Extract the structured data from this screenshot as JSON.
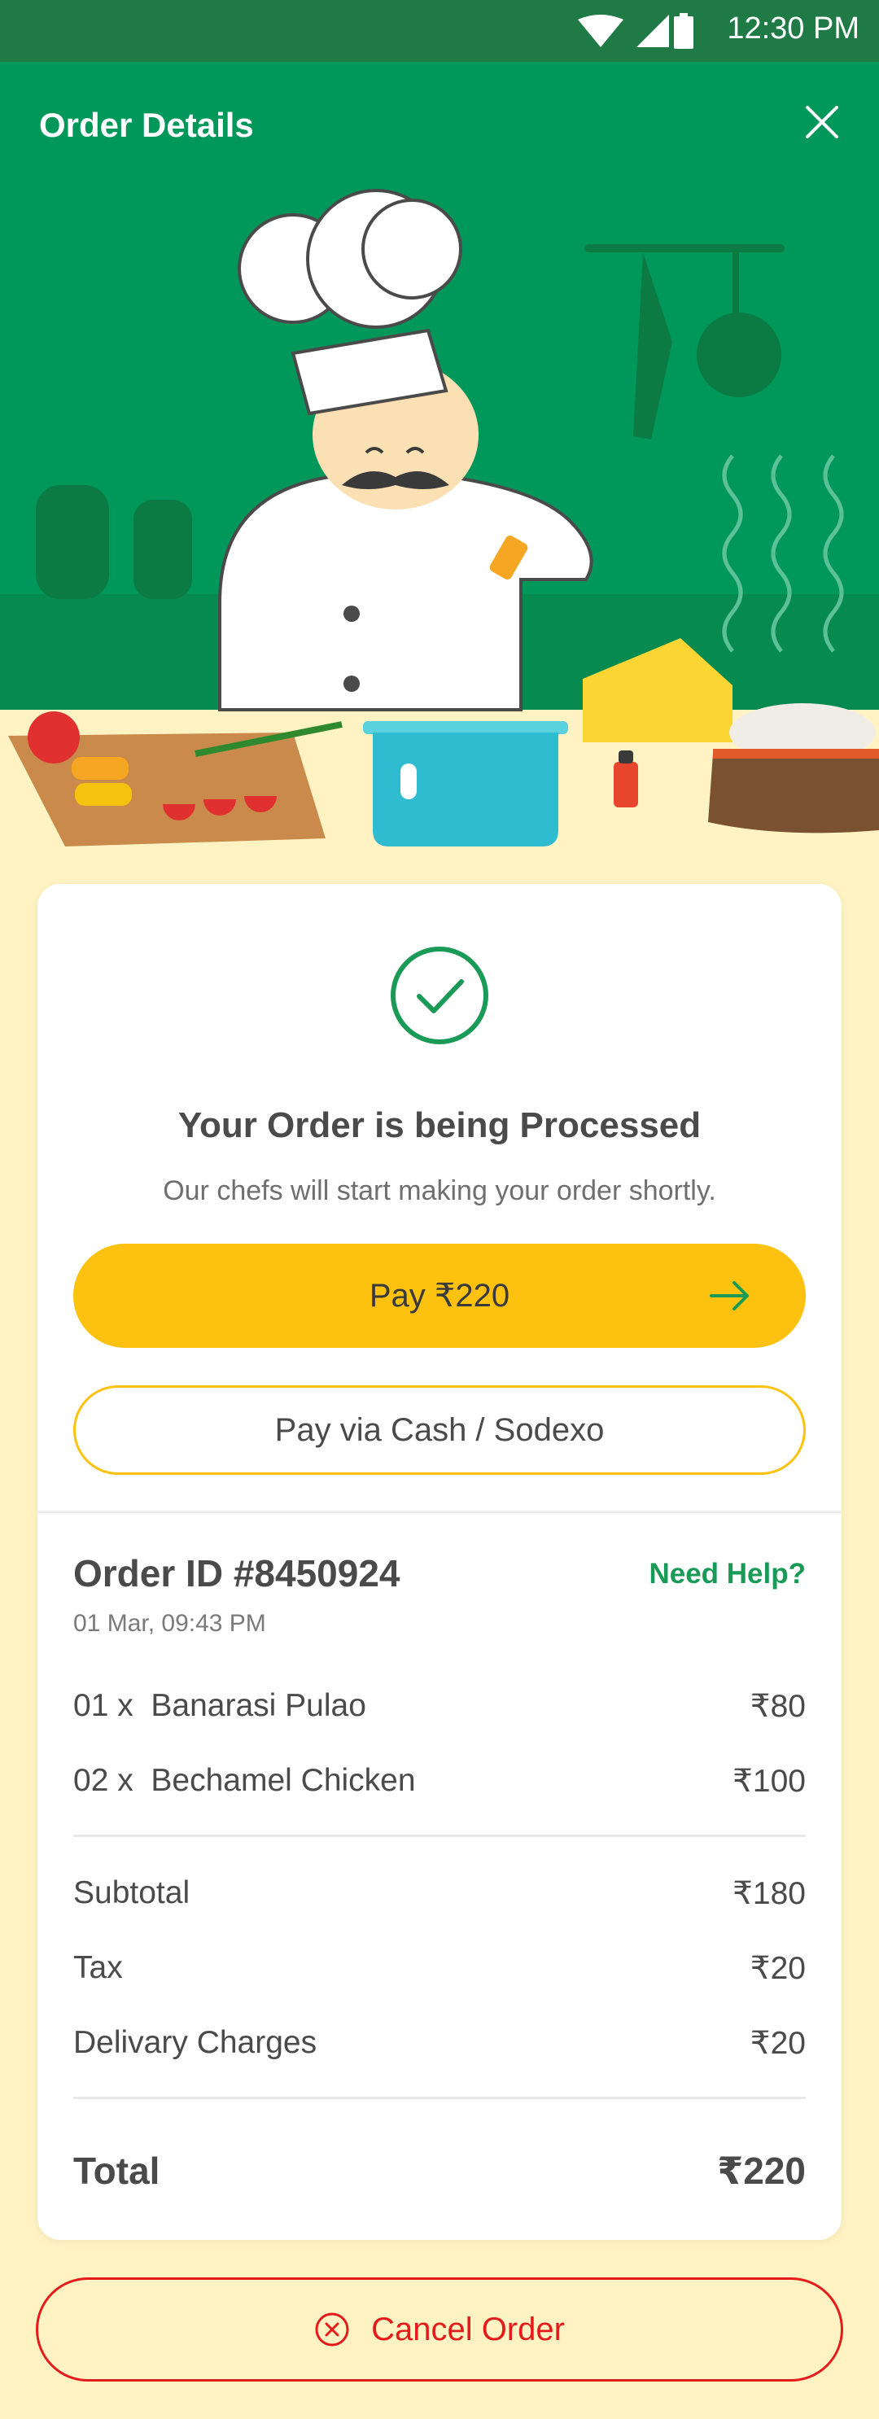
{
  "status_bar": {
    "time": "12:30 PM"
  },
  "header": {
    "title": "Order Details"
  },
  "status": {
    "title": "Your Order is being Processed",
    "subtitle": "Our chefs will start making your order shortly."
  },
  "actions": {
    "pay_label": "Pay ₹220",
    "cash_label": "Pay via Cash / Sodexo",
    "cancel_label": "Cancel Order"
  },
  "order": {
    "id": "Order ID #8450924",
    "help": "Need Help?",
    "datetime": "01 Mar, 09:43 PM",
    "items": [
      {
        "qty": "01 x",
        "name": "Banarasi Pulao",
        "price": "₹80"
      },
      {
        "qty": "02 x",
        "name": "Bechamel Chicken",
        "price": "₹100"
      }
    ],
    "subtotal_label": "Subtotal",
    "subtotal": "₹180",
    "tax_label": "Tax",
    "tax": "₹20",
    "delivery_label": "Delivary Charges",
    "delivery": "₹20",
    "total_label": "Total",
    "total": "₹220"
  },
  "colors": {
    "brand_green": "#00985a",
    "accent_yellow": "#fcc20f",
    "danger_red": "#e31b1b"
  }
}
